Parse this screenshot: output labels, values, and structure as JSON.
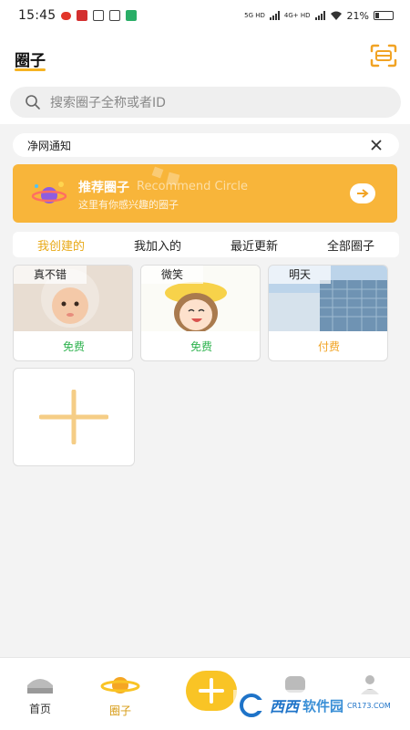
{
  "status_bar": {
    "time": "15:45",
    "network1": "5G HD",
    "network2": "4G+ HD",
    "battery": "21%"
  },
  "header": {
    "title": "圈子",
    "scan_icon": "scan-icon"
  },
  "search": {
    "placeholder": "搜索圈子全称或者ID"
  },
  "notice": {
    "text": "净网通知"
  },
  "banner": {
    "title": "推荐圈子",
    "subtitle_en": "Recommend Circle",
    "description": "这里有你感兴趣的圈子"
  },
  "tabs": [
    {
      "label": "我创建的",
      "active": true
    },
    {
      "label": "我加入的",
      "active": false
    },
    {
      "label": "最近更新",
      "active": false
    },
    {
      "label": "全部圈子",
      "active": false
    }
  ],
  "circles": [
    {
      "name": "真不错",
      "price": "免费"
    },
    {
      "name": "微笑",
      "price": "免费"
    },
    {
      "name": "明天",
      "price": "付费"
    }
  ],
  "bottom_nav": [
    {
      "label": "首页",
      "active": false
    },
    {
      "label": "圈子",
      "active": true
    }
  ],
  "watermark": {
    "brand": "西西",
    "product": "软件园",
    "domain": "CR173.COM"
  },
  "colors": {
    "accent": "#f5b324",
    "free": "#2fb34f",
    "paid": "#f1a324"
  }
}
